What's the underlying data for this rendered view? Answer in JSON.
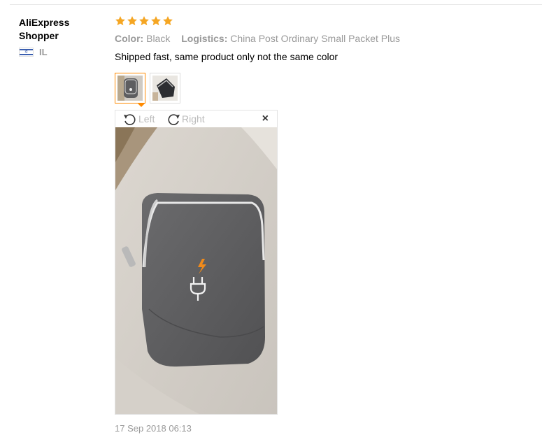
{
  "reviewer": {
    "name": "AliExpress Shopper",
    "country_code": "IL",
    "flag_icon": "israel-flag-icon"
  },
  "review": {
    "rating": 5,
    "rating_max": 5,
    "star_color": "#f5a623",
    "color_label": "Color:",
    "color_value": "Black",
    "logistics_label": "Logistics:",
    "logistics_value": "China Post Ordinary Small Packet Plus",
    "text": "Shipped fast, same product only not the same color",
    "date": "17 Sep 2018 06:13"
  },
  "gallery": {
    "thumbnails": [
      {
        "icon": "photo-thumbnail-gray-pouch",
        "active": true
      },
      {
        "icon": "photo-thumbnail-dark-pouch",
        "active": false
      }
    ],
    "viewer": {
      "rotate_left_label": "Left",
      "rotate_right_label": "Right",
      "close_label": "×",
      "image": "gray-zipper-pouch-photo"
    },
    "accent_color": "#ff8a00"
  }
}
